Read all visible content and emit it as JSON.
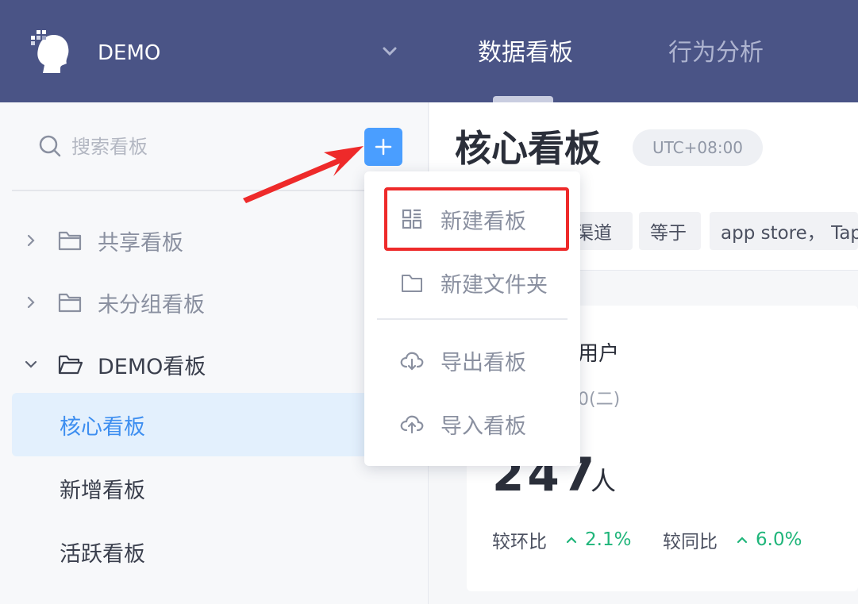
{
  "header": {
    "app_name": "DEMO",
    "tabs": [
      {
        "label": "数据看板",
        "active": true
      },
      {
        "label": "行为分析",
        "active": false
      }
    ]
  },
  "sidebar": {
    "search_placeholder": "搜索看板",
    "tree": [
      {
        "label": "共享看板",
        "expanded": false
      },
      {
        "label": "未分组看板",
        "expanded": false
      },
      {
        "label": "DEMO看板",
        "expanded": true
      }
    ],
    "boards": [
      {
        "label": "核心看板",
        "active": true
      },
      {
        "label": "新增看板",
        "active": false
      },
      {
        "label": "活跃看板",
        "active": false
      }
    ]
  },
  "main": {
    "title": "核心看板",
    "timezone": "UTC+08:00",
    "filters": [
      "渠道",
      "等于",
      "app store， Tapta"
    ],
    "card": {
      "title": "用户",
      "date": "0(二)",
      "value": "247",
      "unit": "人",
      "stats": [
        {
          "label": "较环比",
          "value": "2.1%"
        },
        {
          "label": "较同比",
          "value": "6.0%"
        }
      ]
    }
  },
  "dropdown": {
    "items": [
      {
        "label": "新建看板",
        "icon": "grid-icon"
      },
      {
        "label": "新建文件夹",
        "icon": "folder-icon"
      },
      {
        "label": "导出看板",
        "icon": "cloud-download-icon"
      },
      {
        "label": "导入看板",
        "icon": "cloud-upload-icon"
      }
    ]
  },
  "colors": {
    "header_bg": "#4a5486",
    "accent": "#4a9eff",
    "highlight": "#ee2a2a",
    "positive": "#1fb57a"
  }
}
